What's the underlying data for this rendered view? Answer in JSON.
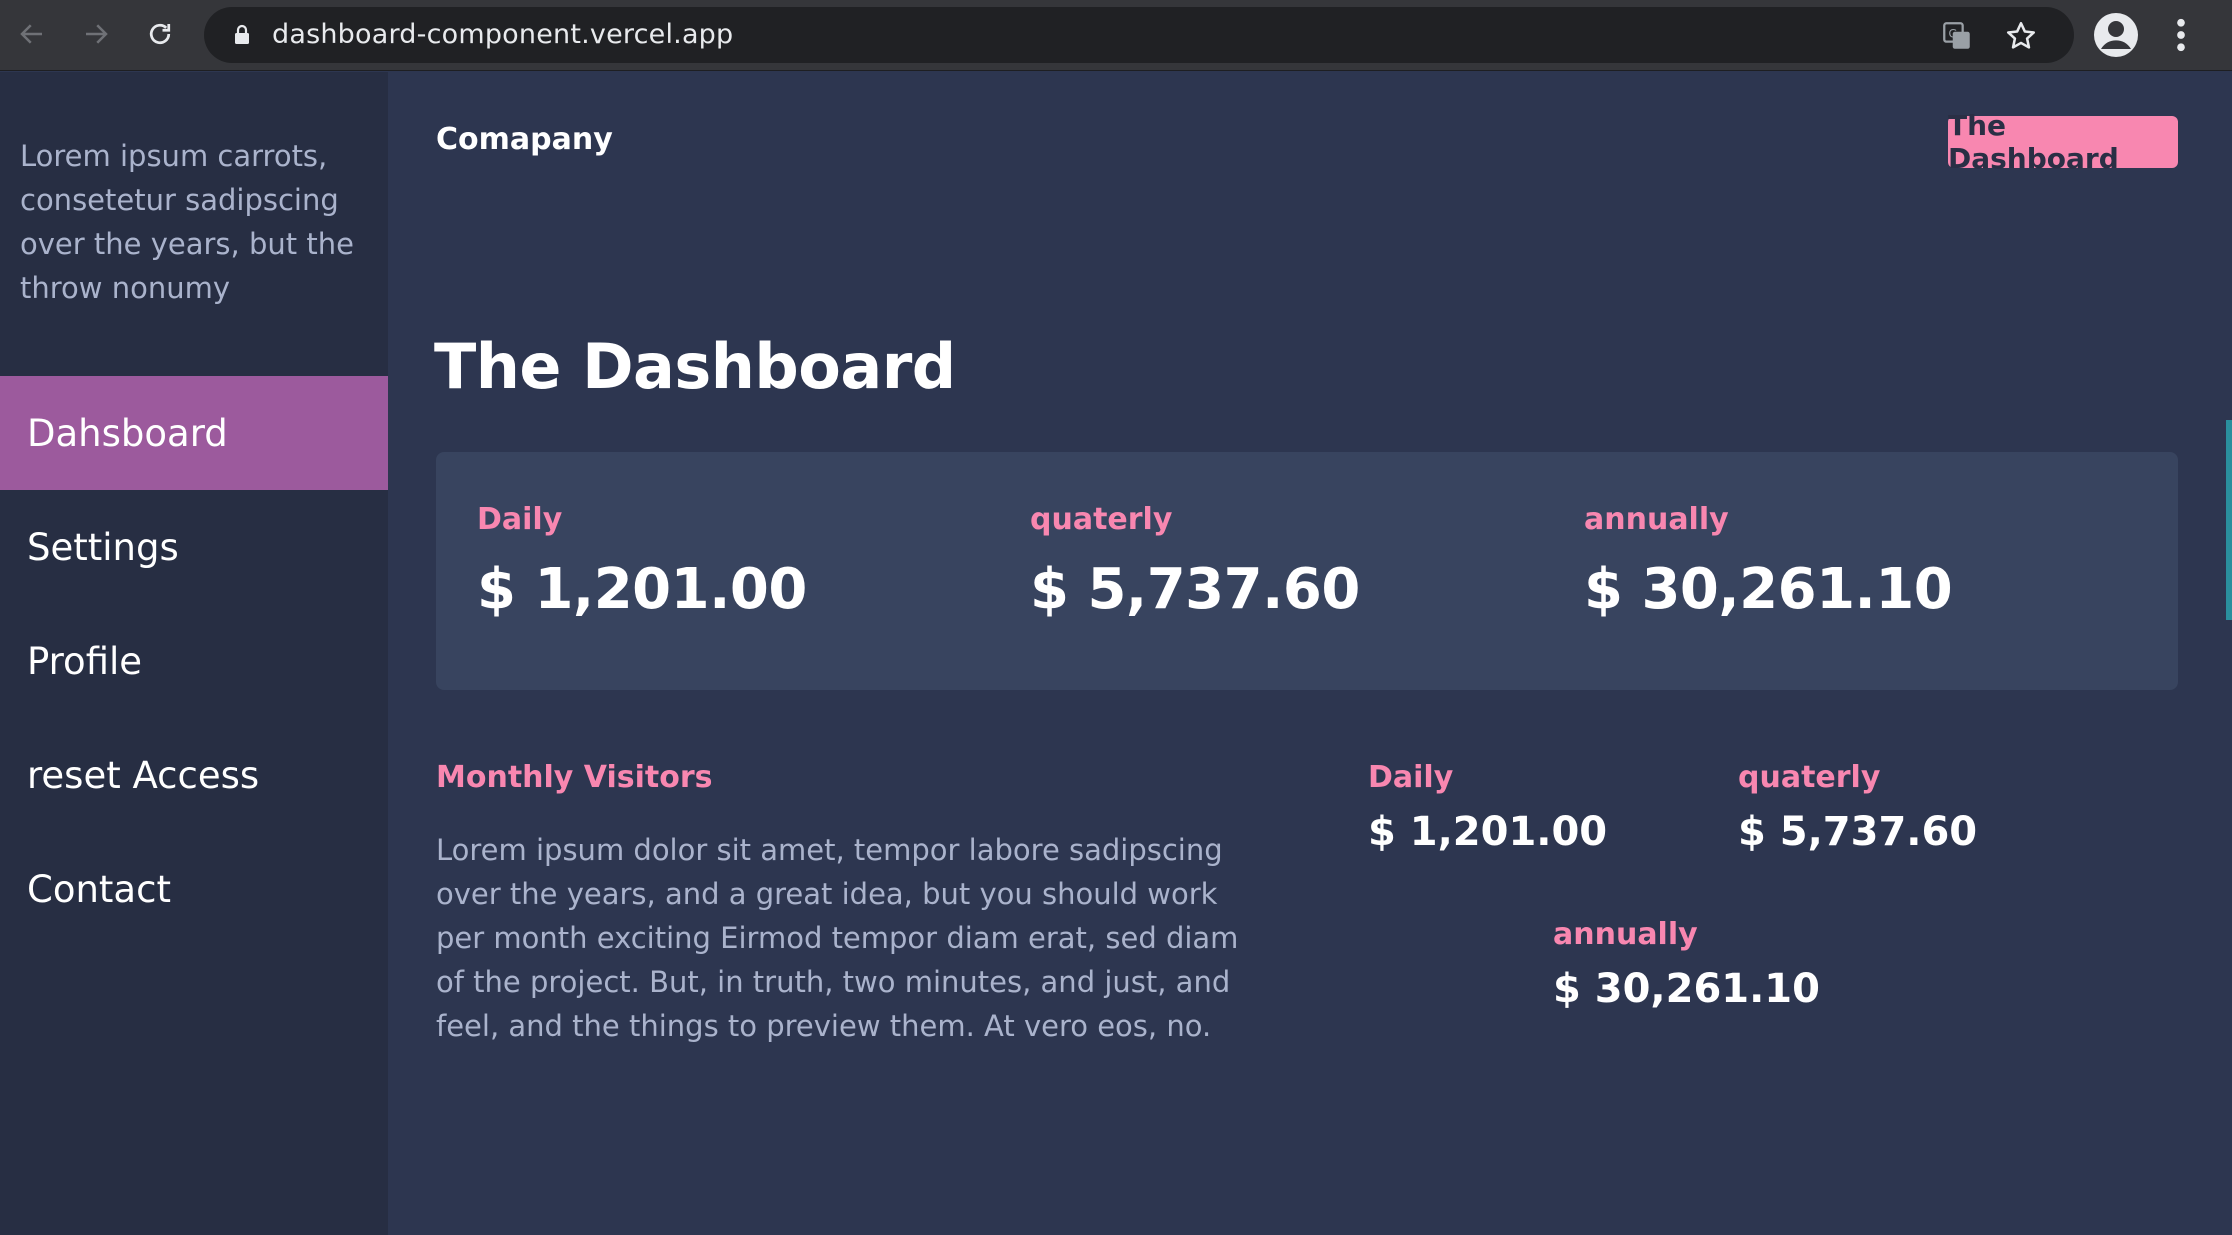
{
  "browser": {
    "url": "dashboard-component.vercel.app"
  },
  "sidebar": {
    "intro": "Lorem ipsum carrots, consetetur sadipscing over the years, but the throw nonumy",
    "items": [
      {
        "label": "Dahsboard"
      },
      {
        "label": "Settings"
      },
      {
        "label": "Profile"
      },
      {
        "label": "reset Access"
      },
      {
        "label": "Contact"
      }
    ]
  },
  "header": {
    "brand": "Comapany",
    "button_label": "The Dashboard"
  },
  "main": {
    "title": "The Dashboard",
    "stats": [
      {
        "label": "Daily",
        "value": "$ 1,201.00"
      },
      {
        "label": "quaterly",
        "value": "$ 5,737.60"
      },
      {
        "label": "annually",
        "value": "$ 30,261.10"
      }
    ],
    "visitors": {
      "title": "Monthly Visitors",
      "text": "Lorem ipsum dolor sit amet, tempor labore sadipscing over the years, and a great idea, but you should work per month exciting Eirmod tempor diam erat, sed diam of the project. But, in truth, two minutes, and just, and feel, and the things to preview them. At vero eos, no."
    },
    "mini_stats": [
      {
        "label": "Daily",
        "value": "$ 1,201.00"
      },
      {
        "label": "quaterly",
        "value": "$ 5,737.60"
      },
      {
        "label": "annually",
        "value": "$ 30,261.10"
      }
    ]
  },
  "colors": {
    "accent": "#f887b0",
    "active_menu": "#9c5a9d",
    "sidebar_bg": "#272e43",
    "main_bg": "#2d3650",
    "card_bg": "#38445f"
  },
  "icons": {
    "back": "back-arrow-icon",
    "forward": "forward-arrow-icon",
    "reload": "reload-icon",
    "lock": "lock-icon",
    "translate": "translate-icon",
    "bookmark": "star-icon",
    "profile": "account-circle-icon",
    "menu": "kebab-menu-icon"
  }
}
